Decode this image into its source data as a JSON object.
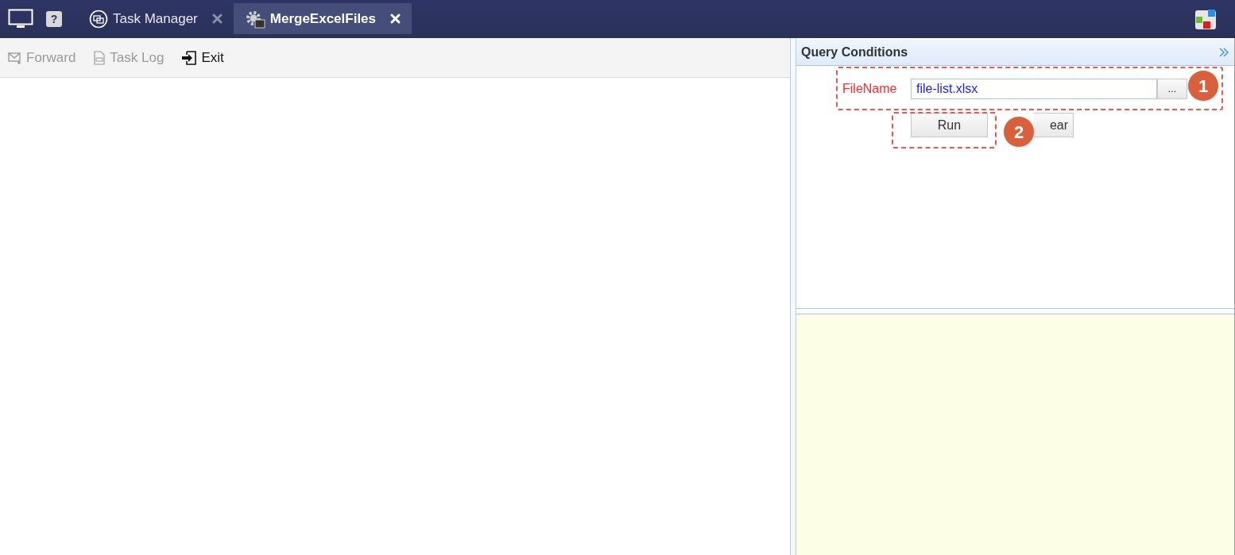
{
  "help": "?",
  "tabs": [
    {
      "label": "Task Manager",
      "selected": false,
      "kind": "monitor"
    },
    {
      "label": "MergeExcelFiles",
      "selected": true,
      "kind": "gear"
    }
  ],
  "toolbar": [
    {
      "label": "Forward",
      "disabled": true,
      "kind": "mail"
    },
    {
      "label": "Task Log",
      "disabled": true,
      "kind": "log"
    },
    {
      "label": "Exit",
      "disabled": false,
      "kind": "exit"
    }
  ],
  "query_panel": {
    "title": "Query Conditions",
    "field": {
      "label": "FileName",
      "value": "file-list.xlsx",
      "browse": "..."
    },
    "buttons": [
      "Run",
      "ear"
    ]
  },
  "annotations": [
    {
      "number": "1"
    },
    {
      "number": "2"
    }
  ]
}
